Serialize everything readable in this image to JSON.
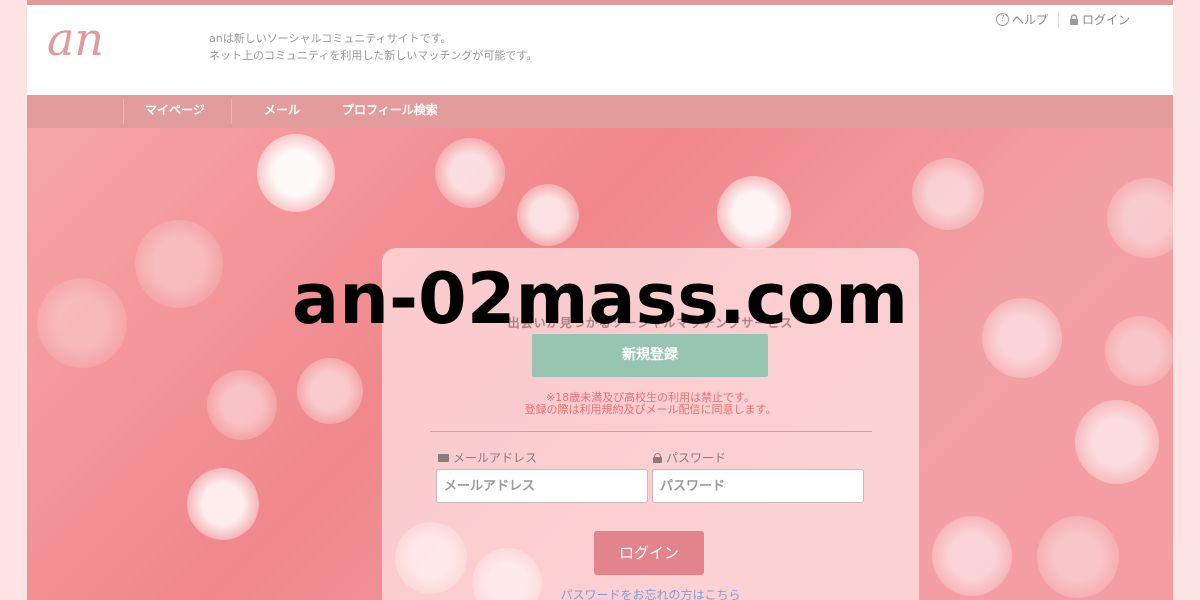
{
  "header": {
    "logo_text": "an",
    "tagline_1": "anは新しいソーシャルコミュニティサイトです。",
    "tagline_2": "ネット上のコミュニティを利用した新しいマッチングが可能です。",
    "help_label": "ヘルプ",
    "login_label": "ログイン"
  },
  "nav": {
    "items": [
      {
        "label": "マイページ"
      },
      {
        "label": "メール"
      },
      {
        "label": "プロフィール検索"
      }
    ]
  },
  "panel": {
    "catch_copy": "出会いが見つかるソーシャルマッチングサービス",
    "register_label": "新規登録",
    "notice_1": "※18歳未満及び高校生の利用は禁止です。",
    "notice_2": "登録の際は利用規約及びメール配信に同意します。",
    "email_label": "メールアドレス",
    "email_placeholder": "メールアドレス",
    "password_label": "パスワード",
    "password_placeholder": "パスワード",
    "login_button": "ログイン",
    "forgot_link": "パスワードをお忘れの方はこちら"
  },
  "watermark": "an-02mass.com",
  "colors": {
    "accent": "#e29c9c",
    "register": "#97c5b2",
    "login_button": "#e1848b",
    "notice": "#e56f74"
  }
}
